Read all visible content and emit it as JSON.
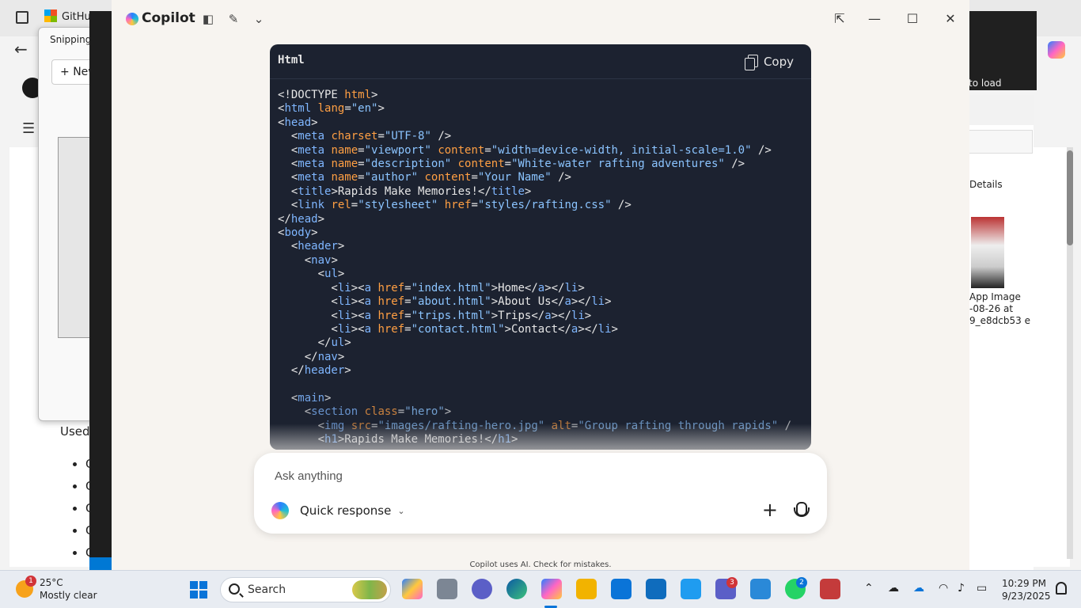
{
  "background": {
    "browser_tab_label": "GitHu",
    "snipping_title": "Snipping",
    "snipping_new": "New",
    "used_text": "Used",
    "bullet_texts": [
      "C",
      "C",
      "C",
      "C",
      "C"
    ],
    "right_window_text": "to load",
    "explorer_details": "Details",
    "explorer_file_caption": "App Image -08-26 at 9_e8dcb53 e"
  },
  "copilot": {
    "title": "Copilot",
    "codeblock": {
      "language": "Html",
      "copy_label": "Copy",
      "lines": [
        [
          [
            "k",
            "<!DOCTYPE "
          ],
          [
            "a",
            "html"
          ],
          [
            "k",
            ">"
          ]
        ],
        [
          [
            "k",
            "<"
          ],
          [
            "t",
            "html "
          ],
          [
            "a",
            "lang"
          ],
          [
            "k",
            "="
          ],
          [
            "s",
            "\"en\""
          ],
          [
            "k",
            ">"
          ]
        ],
        [
          [
            "k",
            "<"
          ],
          [
            "t",
            "head"
          ],
          [
            "k",
            ">"
          ]
        ],
        [
          [
            "k",
            "  <"
          ],
          [
            "t",
            "meta "
          ],
          [
            "a",
            "charset"
          ],
          [
            "k",
            "="
          ],
          [
            "s",
            "\"UTF-8\""
          ],
          [
            "k",
            " />"
          ]
        ],
        [
          [
            "k",
            "  <"
          ],
          [
            "t",
            "meta "
          ],
          [
            "a",
            "name"
          ],
          [
            "k",
            "="
          ],
          [
            "s",
            "\"viewport\" "
          ],
          [
            "a",
            "content"
          ],
          [
            "k",
            "="
          ],
          [
            "s",
            "\"width=device-width, initial-scale=1.0\""
          ],
          [
            "k",
            " />"
          ]
        ],
        [
          [
            "k",
            "  <"
          ],
          [
            "t",
            "meta "
          ],
          [
            "a",
            "name"
          ],
          [
            "k",
            "="
          ],
          [
            "s",
            "\"description\" "
          ],
          [
            "a",
            "content"
          ],
          [
            "k",
            "="
          ],
          [
            "s",
            "\"White-water rafting adventures\""
          ],
          [
            "k",
            " />"
          ]
        ],
        [
          [
            "k",
            "  <"
          ],
          [
            "t",
            "meta "
          ],
          [
            "a",
            "name"
          ],
          [
            "k",
            "="
          ],
          [
            "s",
            "\"author\" "
          ],
          [
            "a",
            "content"
          ],
          [
            "k",
            "="
          ],
          [
            "s",
            "\"Your Name\""
          ],
          [
            "k",
            " />"
          ]
        ],
        [
          [
            "k",
            "  <"
          ],
          [
            "t",
            "title"
          ],
          [
            "k",
            ">Rapids Make Memories!</"
          ],
          [
            "t",
            "title"
          ],
          [
            "k",
            ">"
          ]
        ],
        [
          [
            "k",
            "  <"
          ],
          [
            "t",
            "link "
          ],
          [
            "a",
            "rel"
          ],
          [
            "k",
            "="
          ],
          [
            "s",
            "\"stylesheet\" "
          ],
          [
            "a",
            "href"
          ],
          [
            "k",
            "="
          ],
          [
            "s",
            "\"styles/rafting.css\""
          ],
          [
            "k",
            " />"
          ]
        ],
        [
          [
            "k",
            "</"
          ],
          [
            "t",
            "head"
          ],
          [
            "k",
            ">"
          ]
        ],
        [
          [
            "k",
            "<"
          ],
          [
            "t",
            "body"
          ],
          [
            "k",
            ">"
          ]
        ],
        [
          [
            "k",
            "  <"
          ],
          [
            "t",
            "header"
          ],
          [
            "k",
            ">"
          ]
        ],
        [
          [
            "k",
            "    <"
          ],
          [
            "t",
            "nav"
          ],
          [
            "k",
            ">"
          ]
        ],
        [
          [
            "k",
            "      <"
          ],
          [
            "t",
            "ul"
          ],
          [
            "k",
            ">"
          ]
        ],
        [
          [
            "k",
            "        <"
          ],
          [
            "t",
            "li"
          ],
          [
            "k",
            "><"
          ],
          [
            "t",
            "a "
          ],
          [
            "a",
            "href"
          ],
          [
            "k",
            "="
          ],
          [
            "s",
            "\"index.html\""
          ],
          [
            "k",
            ">Home</"
          ],
          [
            "t",
            "a"
          ],
          [
            "k",
            "></"
          ],
          [
            "t",
            "li"
          ],
          [
            "k",
            ">"
          ]
        ],
        [
          [
            "k",
            "        <"
          ],
          [
            "t",
            "li"
          ],
          [
            "k",
            "><"
          ],
          [
            "t",
            "a "
          ],
          [
            "a",
            "href"
          ],
          [
            "k",
            "="
          ],
          [
            "s",
            "\"about.html\""
          ],
          [
            "k",
            ">About Us</"
          ],
          [
            "t",
            "a"
          ],
          [
            "k",
            "></"
          ],
          [
            "t",
            "li"
          ],
          [
            "k",
            ">"
          ]
        ],
        [
          [
            "k",
            "        <"
          ],
          [
            "t",
            "li"
          ],
          [
            "k",
            "><"
          ],
          [
            "t",
            "a "
          ],
          [
            "a",
            "href"
          ],
          [
            "k",
            "="
          ],
          [
            "s",
            "\"trips.html\""
          ],
          [
            "k",
            ">Trips</"
          ],
          [
            "t",
            "a"
          ],
          [
            "k",
            "></"
          ],
          [
            "t",
            "li"
          ],
          [
            "k",
            ">"
          ]
        ],
        [
          [
            "k",
            "        <"
          ],
          [
            "t",
            "li"
          ],
          [
            "k",
            "><"
          ],
          [
            "t",
            "a "
          ],
          [
            "a",
            "href"
          ],
          [
            "k",
            "="
          ],
          [
            "s",
            "\"contact.html\""
          ],
          [
            "k",
            ">Contact</"
          ],
          [
            "t",
            "a"
          ],
          [
            "k",
            "></"
          ],
          [
            "t",
            "li"
          ],
          [
            "k",
            ">"
          ]
        ],
        [
          [
            "k",
            "      </"
          ],
          [
            "t",
            "ul"
          ],
          [
            "k",
            ">"
          ]
        ],
        [
          [
            "k",
            "    </"
          ],
          [
            "t",
            "nav"
          ],
          [
            "k",
            ">"
          ]
        ],
        [
          [
            "k",
            "  </"
          ],
          [
            "t",
            "header"
          ],
          [
            "k",
            ">"
          ]
        ],
        [
          [
            "k",
            ""
          ]
        ],
        [
          [
            "k",
            "  <"
          ],
          [
            "t",
            "main"
          ],
          [
            "k",
            ">"
          ]
        ],
        [
          [
            "k",
            "    <"
          ],
          [
            "t",
            "section "
          ],
          [
            "a",
            "class"
          ],
          [
            "k",
            "="
          ],
          [
            "s",
            "\"hero\""
          ],
          [
            "k",
            ">"
          ]
        ],
        [
          [
            "k",
            "      <"
          ],
          [
            "t",
            "img "
          ],
          [
            "a",
            "src"
          ],
          [
            "k",
            "="
          ],
          [
            "s",
            "\"images/rafting-hero.jpg\" "
          ],
          [
            "a",
            "alt"
          ],
          [
            "k",
            "="
          ],
          [
            "s",
            "\"Group rafting through rapids\""
          ],
          [
            "k",
            " /"
          ]
        ],
        [
          [
            "k",
            "      <"
          ],
          [
            "t",
            "h1"
          ],
          [
            "k",
            ">Rapids Make Memories!</"
          ],
          [
            "t",
            "h1"
          ],
          [
            "k",
            ">"
          ]
        ]
      ]
    },
    "ask_placeholder": "Ask anything",
    "mode_label": "Quick response",
    "disclaimer": "Copilot uses AI. Check for mistakes."
  },
  "taskbar": {
    "weather_temp": "25°C",
    "weather_desc": "Mostly clear",
    "weather_badge": "1",
    "search_label": "Search",
    "teams_badge": "3",
    "whatsapp_badge": "2",
    "time": "10:29 PM",
    "date": "9/23/2025"
  }
}
